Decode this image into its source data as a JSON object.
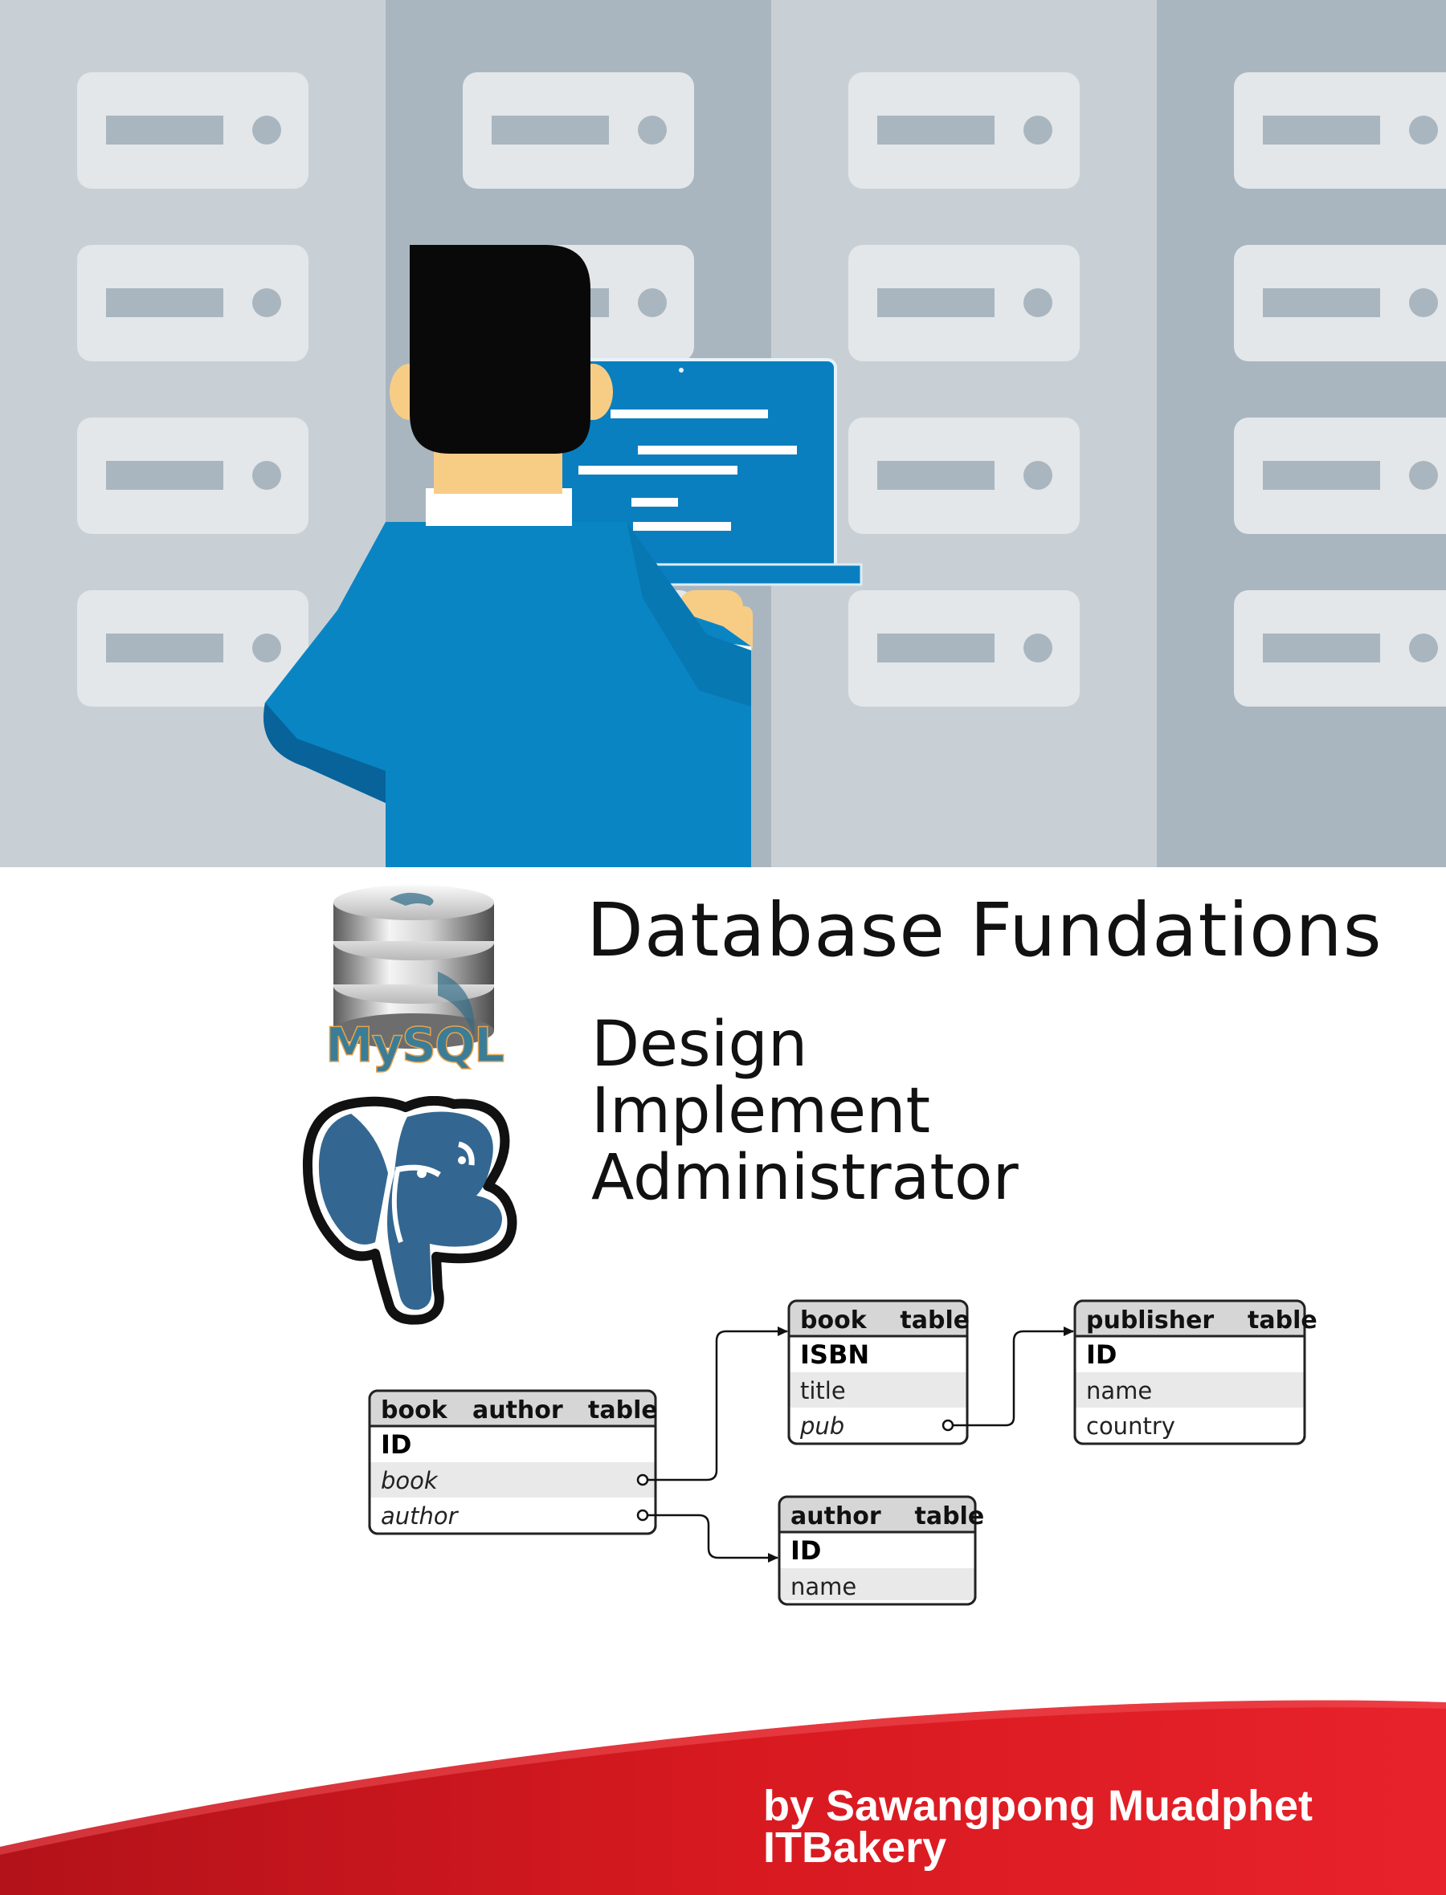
{
  "cover": {
    "title": "Database Fundations",
    "subtitles": [
      "Design",
      "Implement",
      "Administrator"
    ],
    "author_line": "by Sawangpong Muadphet",
    "publisher_line": "ITBakery"
  },
  "logos": {
    "mysql": "MySQL"
  },
  "diagram": {
    "book_author_table": {
      "title": "book   author   table",
      "fields": [
        "ID",
        "book",
        "author"
      ]
    },
    "book_table": {
      "title": "book    table",
      "fields": [
        "ISBN",
        "title",
        "pub"
      ]
    },
    "publisher_table": {
      "title": "publisher    table",
      "fields": [
        "ID",
        "name",
        "country"
      ]
    },
    "author_table": {
      "title": "author    table",
      "fields": [
        "ID",
        "name"
      ]
    }
  },
  "colors": {
    "shirt_blue": "#0a85c4",
    "laptop_screen": "#0a7fbf",
    "rack_light": "#c8d0d6",
    "rack_dark": "#a9b6bf",
    "slot": "#e3e7ea",
    "footer_red": "#e01f26",
    "postgres_blue": "#336791"
  }
}
